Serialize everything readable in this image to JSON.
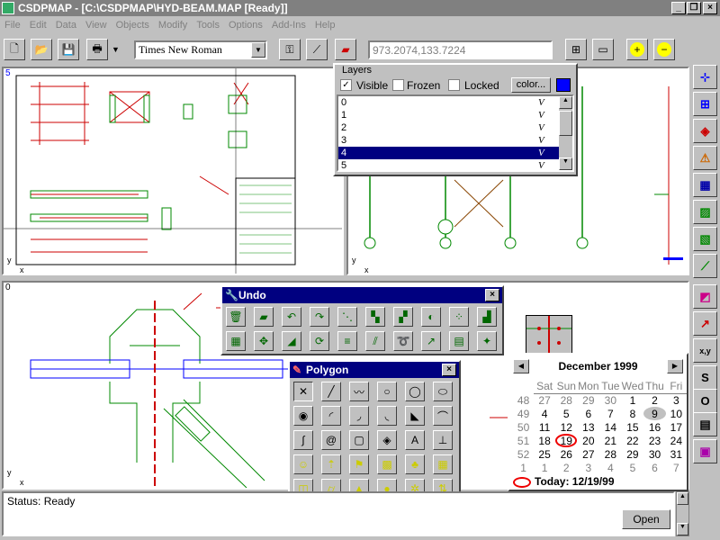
{
  "window": {
    "title": "CSDPMAP - [C:\\CSDPMAP\\HYD-BEAM.MAP [Ready]]"
  },
  "menu": [
    "File",
    "Edit",
    "Data",
    "View",
    "Objects",
    "Modify",
    "Tools",
    "Options",
    "Add-Ins",
    "Help"
  ],
  "toolbar": {
    "font": "Times New Roman",
    "coords": "973.2074,133.7224"
  },
  "layers": {
    "title": "Layers",
    "visible_label": "Visible",
    "frozen_label": "Frozen",
    "locked_label": "Locked",
    "color_label": "color...",
    "color": "#0000ff",
    "rows": [
      {
        "name": "0",
        "flag": "V"
      },
      {
        "name": "1",
        "flag": "V"
      },
      {
        "name": "2",
        "flag": "V"
      },
      {
        "name": "3",
        "flag": "V"
      },
      {
        "name": "4",
        "flag": "V"
      },
      {
        "name": "5",
        "flag": "V"
      }
    ],
    "selected_index": 4
  },
  "views": {
    "top_left_num": "5",
    "bottom_num": "0",
    "axis_x": "x",
    "axis_y": "y"
  },
  "undo_palette": {
    "title": "Undo"
  },
  "polygon_palette": {
    "title": "Polygon"
  },
  "calendar": {
    "month": "December 1999",
    "days": [
      "Sat",
      "Sun",
      "Mon",
      "Tue",
      "Wed",
      "Thu",
      "Fri"
    ],
    "weeks": [
      {
        "wk": "48",
        "d": [
          "27",
          "28",
          "29",
          "30",
          "1",
          "2",
          "3"
        ]
      },
      {
        "wk": "49",
        "d": [
          "4",
          "5",
          "6",
          "7",
          "8",
          "9",
          "10"
        ]
      },
      {
        "wk": "50",
        "d": [
          "11",
          "12",
          "13",
          "14",
          "15",
          "16",
          "17"
        ]
      },
      {
        "wk": "51",
        "d": [
          "18",
          "19",
          "20",
          "21",
          "22",
          "23",
          "24"
        ]
      },
      {
        "wk": "52",
        "d": [
          "25",
          "26",
          "27",
          "28",
          "29",
          "30",
          "31"
        ]
      },
      {
        "wk": "1",
        "d": [
          "1",
          "2",
          "3",
          "4",
          "5",
          "6",
          "7"
        ]
      }
    ],
    "today_label": "Today: 12/19/99"
  },
  "status": {
    "text": "Status: Ready",
    "open_label": "Open"
  },
  "right_bar": {
    "s": "S",
    "o": "O"
  }
}
